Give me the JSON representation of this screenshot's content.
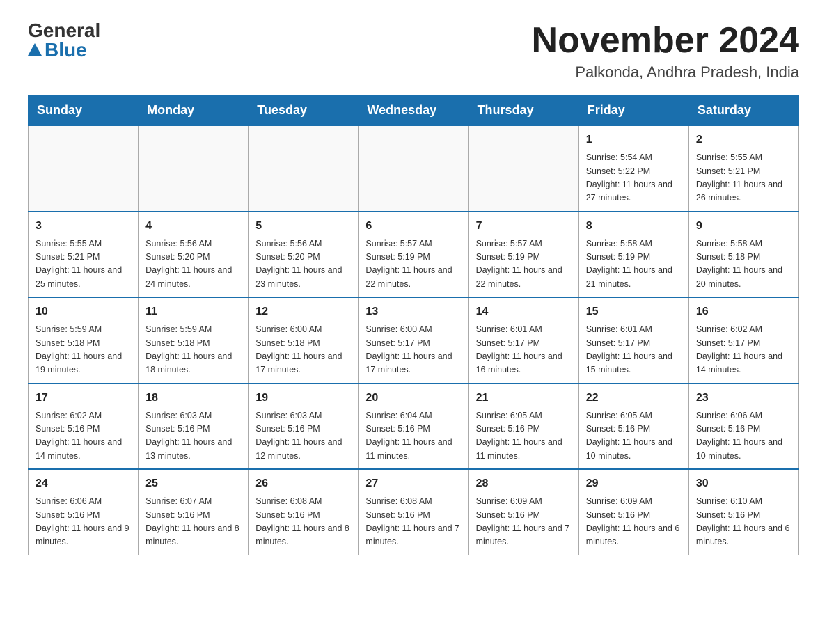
{
  "header": {
    "logo_general": "General",
    "logo_blue": "Blue",
    "month_title": "November 2024",
    "location": "Palkonda, Andhra Pradesh, India"
  },
  "days_of_week": [
    "Sunday",
    "Monday",
    "Tuesday",
    "Wednesday",
    "Thursday",
    "Friday",
    "Saturday"
  ],
  "weeks": [
    [
      {
        "day": "",
        "info": ""
      },
      {
        "day": "",
        "info": ""
      },
      {
        "day": "",
        "info": ""
      },
      {
        "day": "",
        "info": ""
      },
      {
        "day": "",
        "info": ""
      },
      {
        "day": "1",
        "info": "Sunrise: 5:54 AM\nSunset: 5:22 PM\nDaylight: 11 hours and 27 minutes."
      },
      {
        "day": "2",
        "info": "Sunrise: 5:55 AM\nSunset: 5:21 PM\nDaylight: 11 hours and 26 minutes."
      }
    ],
    [
      {
        "day": "3",
        "info": "Sunrise: 5:55 AM\nSunset: 5:21 PM\nDaylight: 11 hours and 25 minutes."
      },
      {
        "day": "4",
        "info": "Sunrise: 5:56 AM\nSunset: 5:20 PM\nDaylight: 11 hours and 24 minutes."
      },
      {
        "day": "5",
        "info": "Sunrise: 5:56 AM\nSunset: 5:20 PM\nDaylight: 11 hours and 23 minutes."
      },
      {
        "day": "6",
        "info": "Sunrise: 5:57 AM\nSunset: 5:19 PM\nDaylight: 11 hours and 22 minutes."
      },
      {
        "day": "7",
        "info": "Sunrise: 5:57 AM\nSunset: 5:19 PM\nDaylight: 11 hours and 22 minutes."
      },
      {
        "day": "8",
        "info": "Sunrise: 5:58 AM\nSunset: 5:19 PM\nDaylight: 11 hours and 21 minutes."
      },
      {
        "day": "9",
        "info": "Sunrise: 5:58 AM\nSunset: 5:18 PM\nDaylight: 11 hours and 20 minutes."
      }
    ],
    [
      {
        "day": "10",
        "info": "Sunrise: 5:59 AM\nSunset: 5:18 PM\nDaylight: 11 hours and 19 minutes."
      },
      {
        "day": "11",
        "info": "Sunrise: 5:59 AM\nSunset: 5:18 PM\nDaylight: 11 hours and 18 minutes."
      },
      {
        "day": "12",
        "info": "Sunrise: 6:00 AM\nSunset: 5:18 PM\nDaylight: 11 hours and 17 minutes."
      },
      {
        "day": "13",
        "info": "Sunrise: 6:00 AM\nSunset: 5:17 PM\nDaylight: 11 hours and 17 minutes."
      },
      {
        "day": "14",
        "info": "Sunrise: 6:01 AM\nSunset: 5:17 PM\nDaylight: 11 hours and 16 minutes."
      },
      {
        "day": "15",
        "info": "Sunrise: 6:01 AM\nSunset: 5:17 PM\nDaylight: 11 hours and 15 minutes."
      },
      {
        "day": "16",
        "info": "Sunrise: 6:02 AM\nSunset: 5:17 PM\nDaylight: 11 hours and 14 minutes."
      }
    ],
    [
      {
        "day": "17",
        "info": "Sunrise: 6:02 AM\nSunset: 5:16 PM\nDaylight: 11 hours and 14 minutes."
      },
      {
        "day": "18",
        "info": "Sunrise: 6:03 AM\nSunset: 5:16 PM\nDaylight: 11 hours and 13 minutes."
      },
      {
        "day": "19",
        "info": "Sunrise: 6:03 AM\nSunset: 5:16 PM\nDaylight: 11 hours and 12 minutes."
      },
      {
        "day": "20",
        "info": "Sunrise: 6:04 AM\nSunset: 5:16 PM\nDaylight: 11 hours and 11 minutes."
      },
      {
        "day": "21",
        "info": "Sunrise: 6:05 AM\nSunset: 5:16 PM\nDaylight: 11 hours and 11 minutes."
      },
      {
        "day": "22",
        "info": "Sunrise: 6:05 AM\nSunset: 5:16 PM\nDaylight: 11 hours and 10 minutes."
      },
      {
        "day": "23",
        "info": "Sunrise: 6:06 AM\nSunset: 5:16 PM\nDaylight: 11 hours and 10 minutes."
      }
    ],
    [
      {
        "day": "24",
        "info": "Sunrise: 6:06 AM\nSunset: 5:16 PM\nDaylight: 11 hours and 9 minutes."
      },
      {
        "day": "25",
        "info": "Sunrise: 6:07 AM\nSunset: 5:16 PM\nDaylight: 11 hours and 8 minutes."
      },
      {
        "day": "26",
        "info": "Sunrise: 6:08 AM\nSunset: 5:16 PM\nDaylight: 11 hours and 8 minutes."
      },
      {
        "day": "27",
        "info": "Sunrise: 6:08 AM\nSunset: 5:16 PM\nDaylight: 11 hours and 7 minutes."
      },
      {
        "day": "28",
        "info": "Sunrise: 6:09 AM\nSunset: 5:16 PM\nDaylight: 11 hours and 7 minutes."
      },
      {
        "day": "29",
        "info": "Sunrise: 6:09 AM\nSunset: 5:16 PM\nDaylight: 11 hours and 6 minutes."
      },
      {
        "day": "30",
        "info": "Sunrise: 6:10 AM\nSunset: 5:16 PM\nDaylight: 11 hours and 6 minutes."
      }
    ]
  ]
}
